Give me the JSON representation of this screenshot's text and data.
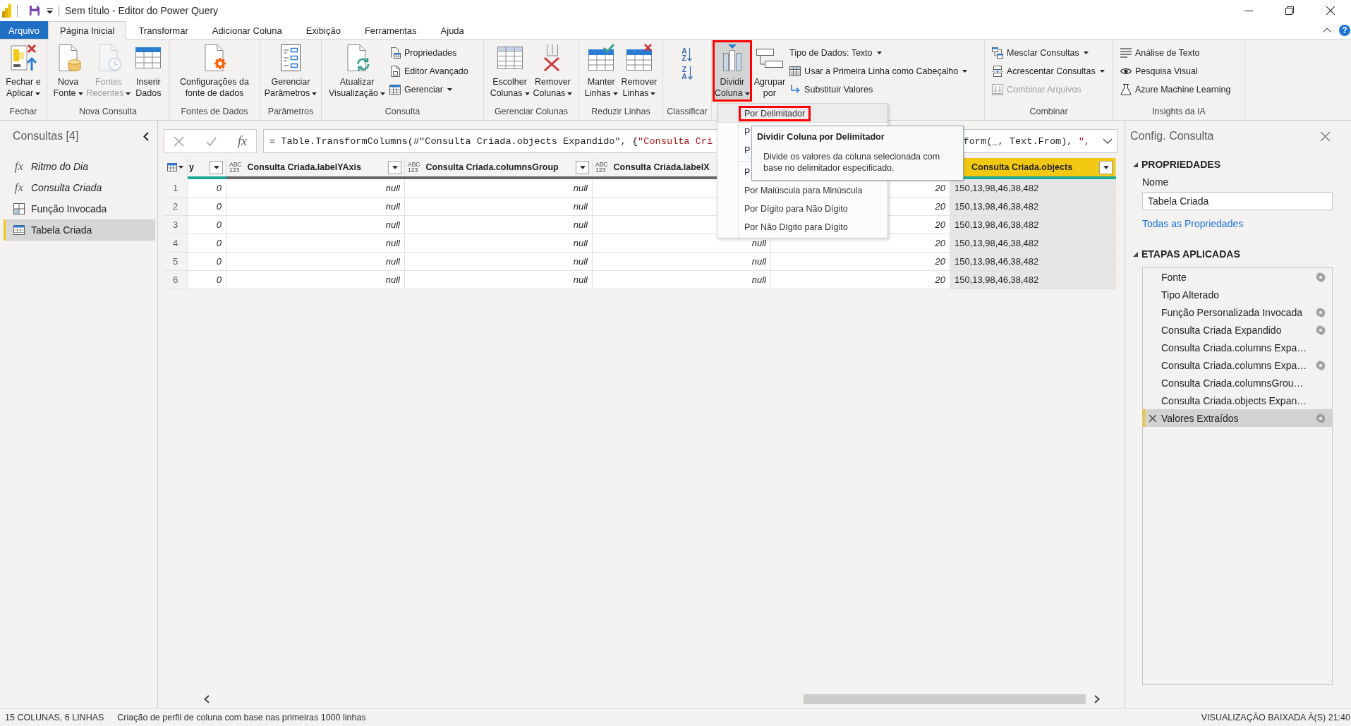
{
  "window": {
    "title": "Sem título - Editor do Power Query"
  },
  "ribbon_tabs": [
    {
      "label": "Arquivo",
      "kind": "file",
      "selected": false
    },
    {
      "label": "Página Inicial",
      "kind": "tab",
      "selected": true
    },
    {
      "label": "Transformar",
      "kind": "tab",
      "selected": false
    },
    {
      "label": "Adicionar Coluna",
      "kind": "tab",
      "selected": false
    },
    {
      "label": "Exibição",
      "kind": "tab",
      "selected": false
    },
    {
      "label": "Ferramentas",
      "kind": "tab",
      "selected": false
    },
    {
      "label": "Ajuda",
      "kind": "tab",
      "selected": false
    }
  ],
  "help_button": "?",
  "ribbon_groups": [
    {
      "label": "Fechar",
      "large_buttons": [
        {
          "label": "Fechar e\nAplicar",
          "dropdown": true,
          "disabled": false,
          "expanded": false,
          "highlighted": false
        }
      ]
    },
    {
      "label": "Nova Consulta",
      "large_buttons": [
        {
          "label": "Nova\nFonte",
          "dropdown": true,
          "disabled": false,
          "expanded": false,
          "highlighted": false
        },
        {
          "label": "Fontes\nRecentes",
          "dropdown": true,
          "disabled": true,
          "expanded": false,
          "highlighted": false
        },
        {
          "label": "Inserir\nDados",
          "dropdown": false,
          "disabled": false,
          "expanded": false,
          "highlighted": false
        }
      ]
    },
    {
      "label": "Fontes de Dados",
      "large_buttons": [
        {
          "label": "Configurações da\nfonte de dados",
          "dropdown": false,
          "disabled": false,
          "expanded": false,
          "highlighted": false
        }
      ]
    },
    {
      "label": "Parâmetros",
      "large_buttons": [
        {
          "label": "Gerenciar\nParâmetros",
          "dropdown": true,
          "disabled": false,
          "expanded": false,
          "highlighted": false
        }
      ]
    },
    {
      "label": "Consulta",
      "large_buttons": [
        {
          "label": "Atualizar\nVisualização",
          "dropdown": true,
          "disabled": false,
          "expanded": false,
          "highlighted": false
        }
      ],
      "small_buttons": [
        {
          "label": "Propriedades",
          "dropdown": false,
          "disabled": false
        },
        {
          "label": "Editor Avançado",
          "dropdown": false,
          "disabled": false
        },
        {
          "label": "Gerenciar",
          "dropdown": true,
          "disabled": false
        }
      ]
    },
    {
      "label": "Gerenciar Colunas",
      "large_buttons": [
        {
          "label": "Escolher\nColunas",
          "dropdown": true,
          "disabled": false,
          "expanded": false,
          "highlighted": false
        },
        {
          "label": "Remover\nColunas",
          "dropdown": true,
          "disabled": false,
          "expanded": false,
          "highlighted": false
        }
      ]
    },
    {
      "label": "Reduzir Linhas",
      "large_buttons": [
        {
          "label": "Manter\nLinhas",
          "dropdown": true,
          "disabled": false,
          "expanded": false,
          "highlighted": false
        },
        {
          "label": "Remover\nLinhas",
          "dropdown": true,
          "disabled": false,
          "expanded": false,
          "highlighted": false
        }
      ]
    },
    {
      "label": "Classificar",
      "icon_buttons": [
        {
          "letters": "A Z"
        },
        {
          "letters": "Z A"
        }
      ]
    },
    {
      "large_buttons": [
        {
          "label": "Dividir\nColuna",
          "dropdown": true,
          "disabled": false,
          "expanded": true,
          "highlighted": true
        },
        {
          "label": "Agrupar\npor",
          "dropdown": false,
          "disabled": false,
          "expanded": false,
          "highlighted": false
        }
      ],
      "small_buttons": [
        {
          "label": "Tipo de Dados: Texto",
          "dropdown": true,
          "disabled": false
        },
        {
          "label": "Usar a Primeira Linha como Cabeçalho",
          "dropdown": true,
          "disabled": false
        },
        {
          "label": "Substituir Valores",
          "dropdown": false,
          "disabled": false
        }
      ]
    },
    {
      "label": "Combinar",
      "small_buttons": [
        {
          "label": "Mesclar Consultas",
          "dropdown": true,
          "disabled": false
        },
        {
          "label": "Acrescentar Consultas",
          "dropdown": true,
          "disabled": false
        },
        {
          "label": "Combinar Arquivos",
          "dropdown": false,
          "disabled": true
        }
      ]
    },
    {
      "label": "Insights da IA",
      "small_buttons": [
        {
          "label": "Análise de Texto",
          "dropdown": false,
          "disabled": false
        },
        {
          "label": "Pesquisa Visual",
          "dropdown": false,
          "disabled": false
        },
        {
          "label": "Azure Machine Learning",
          "dropdown": false,
          "disabled": false
        }
      ]
    }
  ],
  "split_menu": {
    "items": [
      {
        "kind": "item",
        "label": "Por Delimitador",
        "hovered": true,
        "highlighted": true
      },
      {
        "kind": "item",
        "label": "P",
        "hovered": false,
        "highlighted": false
      },
      {
        "kind": "item",
        "label": "P",
        "hovered": false,
        "highlighted": false
      },
      {
        "kind": "separator"
      },
      {
        "kind": "item",
        "label": "P",
        "hovered": false,
        "highlighted": false
      },
      {
        "kind": "item",
        "label": "Por Maiúscula para Minúscula",
        "hovered": false,
        "highlighted": false
      },
      {
        "kind": "item",
        "label": "Por Dígito para Não Dígito",
        "hovered": false,
        "highlighted": false
      },
      {
        "kind": "item",
        "label": "Por Não Dígito para Dígito",
        "hovered": false,
        "highlighted": false
      }
    ],
    "tooltip": {
      "title": "Dividir Coluna por Delimitador",
      "text": "Divide os valores da coluna selecionada com base no delimitador especificado."
    }
  },
  "queries_panel": {
    "title": "Consultas [4]",
    "items": [
      {
        "label": "Ritmo do Dia",
        "kind": "function",
        "glyph": "fx",
        "selected": false
      },
      {
        "label": "Consulta Criada",
        "kind": "function",
        "glyph": "fx",
        "selected": false
      },
      {
        "label": "Função Invocada",
        "kind": "grid",
        "selected": false
      },
      {
        "label": "Tabela Criada",
        "kind": "table",
        "selected": true
      }
    ]
  },
  "formula_bar": {
    "fx_button": "fx",
    "formula_start": [
      {
        "kind": "code",
        "text": "= Table.TransformColumns(#\"Consulta Criada.objects Expandido\", {"
      },
      {
        "kind": "string",
        "text": "\"Consulta Cri"
      }
    ],
    "formula_end": [
      {
        "kind": "code",
        "text": "form(_, Text.From), "
      },
      {
        "kind": "string",
        "text": "\","
      }
    ]
  },
  "table": {
    "columns": [
      {
        "name": "y",
        "kind": "any",
        "color": "#1aab9b",
        "filter": true,
        "selected": false
      },
      {
        "type": "ABC 123",
        "name": "Consulta Criada.labelYAxis",
        "kind": "any",
        "color": "#666666",
        "filter": true,
        "selected": false
      },
      {
        "type": "ABC 123",
        "name": "Consulta Criada.columnsGroup",
        "kind": "any",
        "color": "#666666",
        "filter": true,
        "selected": false
      },
      {
        "type": "ABC 123",
        "name": "Consulta Criada.labelX",
        "kind": "any",
        "color": "#666666",
        "selected": false
      },
      {
        "kind": "any",
        "selected": false
      },
      {
        "name": "Consulta Criada.objects",
        "kind": "text",
        "color": "#1aab9b",
        "filter": true,
        "selected": true
      }
    ],
    "rows": [
      {
        "number": "1",
        "cells": [
          "0",
          "null",
          "null",
          null,
          "20",
          "150,13,98,46,38,482"
        ]
      },
      {
        "number": "2",
        "cells": [
          "0",
          "null",
          "null",
          null,
          "20",
          "150,13,98,46,38,482"
        ]
      },
      {
        "number": "3",
        "cells": [
          "0",
          "null",
          "null",
          null,
          "20",
          "150,13,98,46,38,482"
        ]
      },
      {
        "number": "4",
        "cells": [
          "0",
          "null",
          "null",
          "null",
          "20",
          "150,13,98,46,38,482"
        ]
      },
      {
        "number": "5",
        "cells": [
          "0",
          "null",
          "null",
          "null",
          "20",
          "150,13,98,46,38,482"
        ]
      },
      {
        "number": "6",
        "cells": [
          "0",
          "null",
          "null",
          "null",
          "20",
          "150,13,98,46,38,482"
        ]
      }
    ]
  },
  "settings_panel": {
    "title": "Config. Consulta",
    "properties": {
      "heading": "PROPRIEDADES",
      "name_label": "Nome",
      "name_value": "Tabela Criada",
      "all_properties_link": "Todas as Propriedades"
    },
    "steps": {
      "heading": "ETAPAS APLICADAS",
      "items": [
        {
          "label": "Fonte",
          "settings": true,
          "selected": false
        },
        {
          "label": "Tipo Alterado",
          "settings": false,
          "selected": false
        },
        {
          "label": "Função Personalizada Invocada",
          "settings": true,
          "selected": false
        },
        {
          "label": "Consulta Criada Expandido",
          "settings": true,
          "selected": false
        },
        {
          "label": "Consulta Criada.columns Expa…",
          "settings": false,
          "selected": false
        },
        {
          "label": "Consulta Criada.columns Expa…",
          "settings": true,
          "selected": false
        },
        {
          "label": "Consulta Criada.columnsGrou…",
          "settings": false,
          "selected": false
        },
        {
          "label": "Consulta Criada.objects Expan…",
          "settings": false,
          "selected": false
        },
        {
          "label": "Valores Extraídos",
          "settings": true,
          "selected": true
        }
      ]
    }
  },
  "status_bar": {
    "counts": "15 COLUNAS, 6 LINHAS",
    "profiling": "Criação de perfil de coluna com base nas primeiras 1000 linhas",
    "preview": "VISUALIZAÇÃO BAIXADA À(S) 21:40"
  }
}
